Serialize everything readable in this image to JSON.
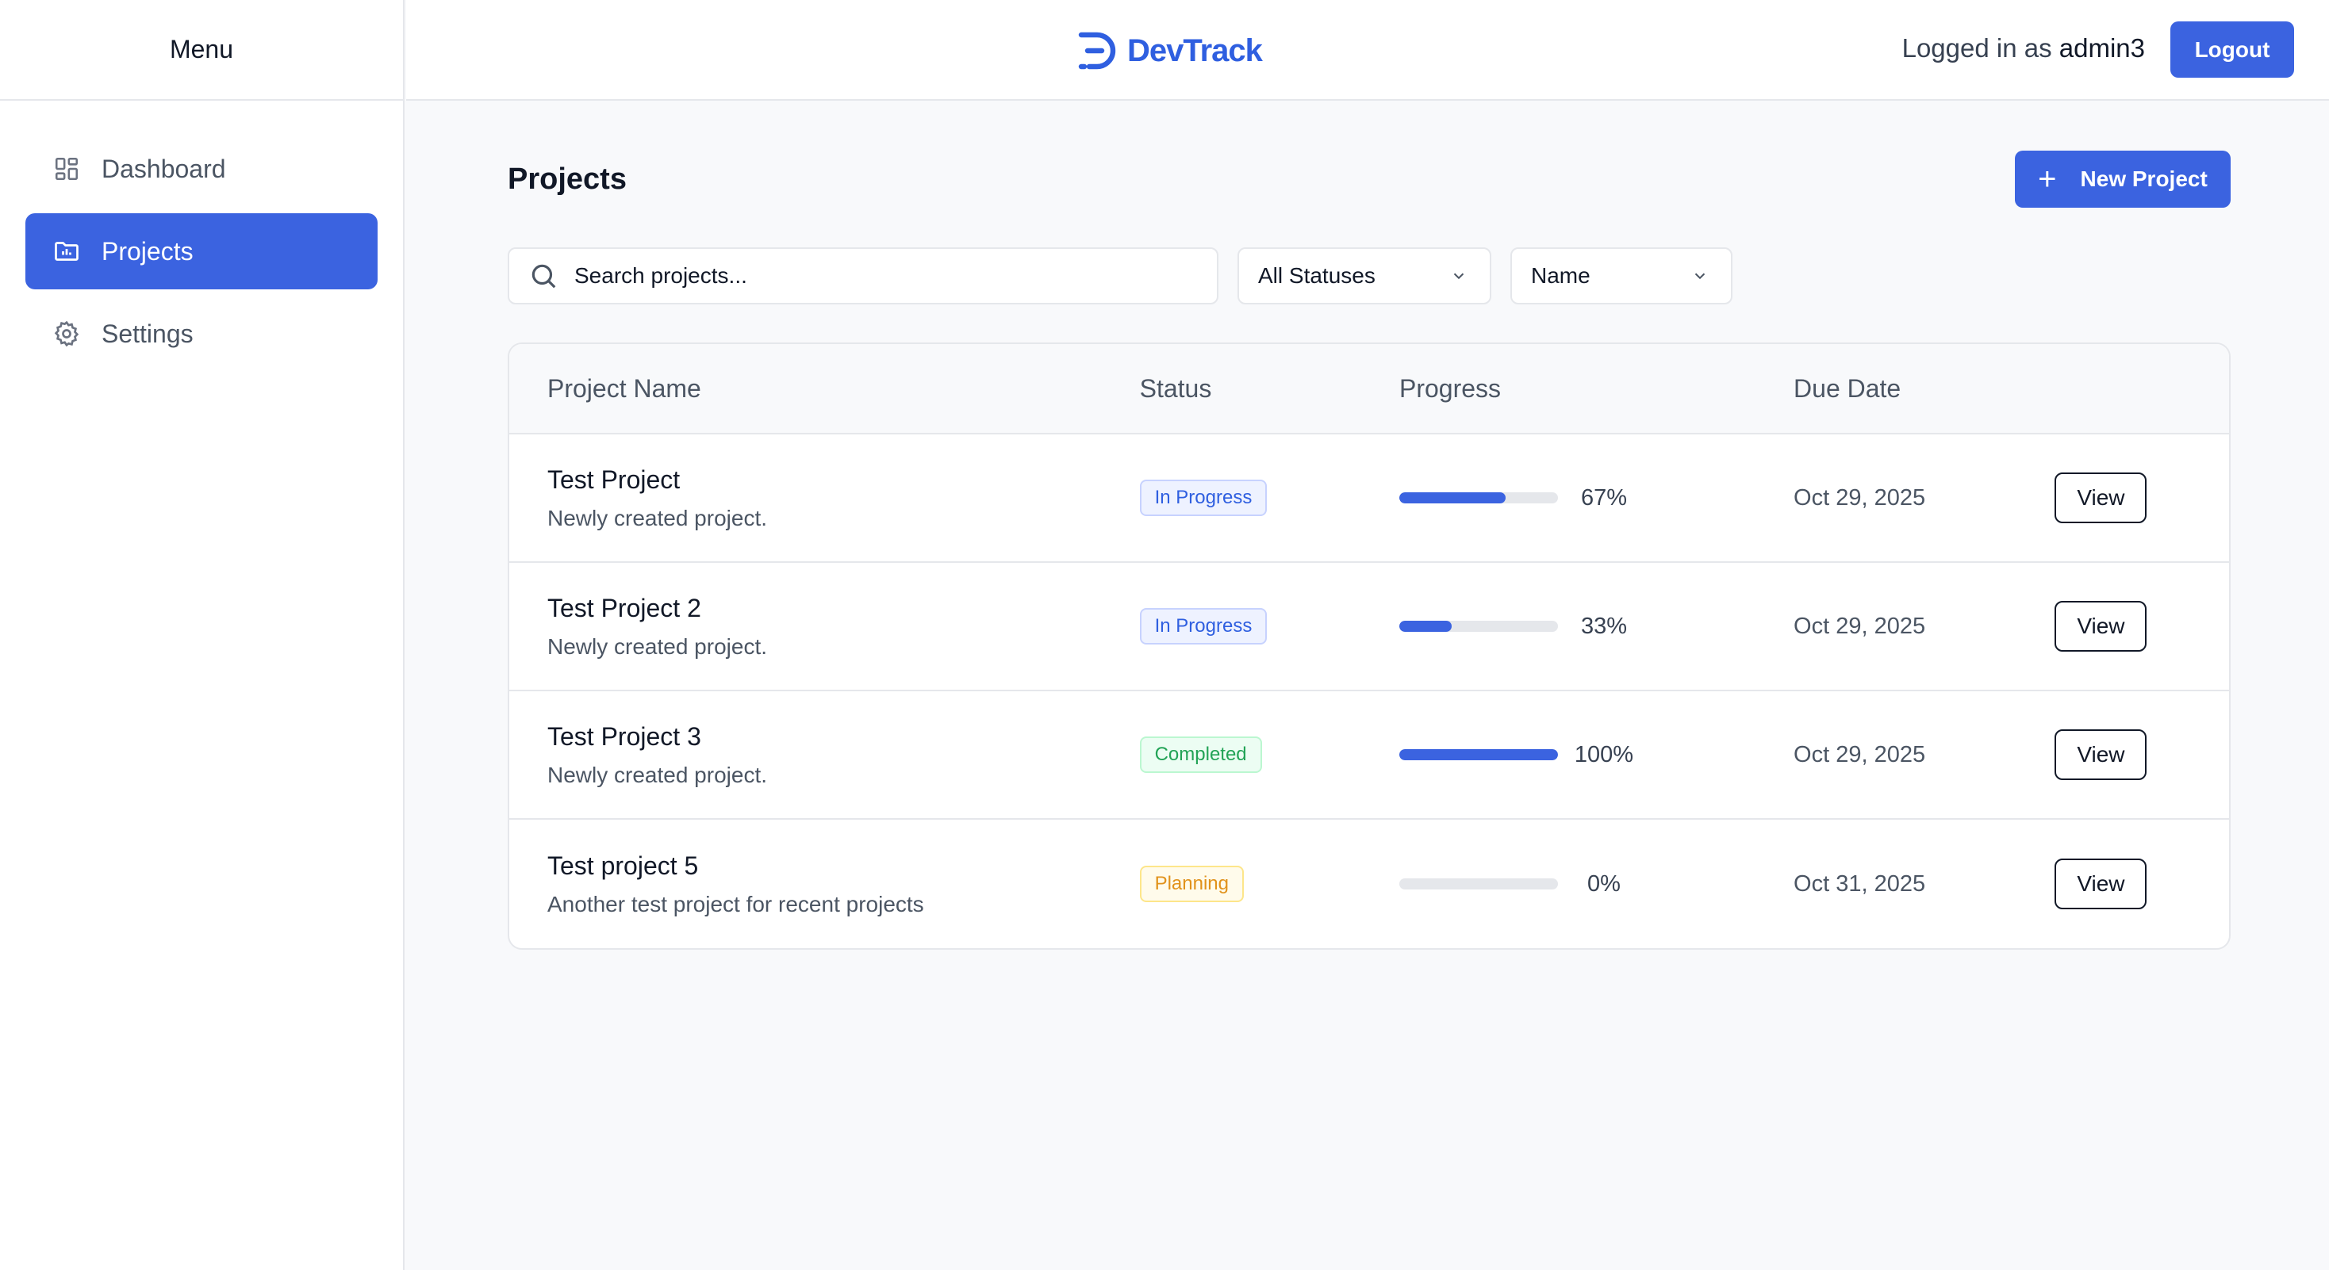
{
  "sidebar": {
    "heading": "Menu",
    "items": [
      {
        "label": "Dashboard",
        "icon": "dashboard-icon"
      },
      {
        "label": "Projects",
        "icon": "folder-chart-icon",
        "active": true
      },
      {
        "label": "Settings",
        "icon": "gear-icon"
      }
    ]
  },
  "header": {
    "brand": "DevTrack",
    "logged_in_prefix": "Logged in as",
    "username": "admin3",
    "logout_label": "Logout"
  },
  "main": {
    "title": "Projects",
    "new_button_label": "New Project",
    "search_placeholder": "Search projects...",
    "status_filter": "All Statuses",
    "sort_by": "Name",
    "columns": [
      "Project Name",
      "Status",
      "Progress",
      "Due Date"
    ],
    "rows": [
      {
        "name": "Test Project",
        "description": "Newly created project.",
        "status": "In Progress",
        "status_kind": "progress",
        "progress": 67,
        "progress_label": "67%",
        "due": "Oct 29, 2025",
        "action": "View"
      },
      {
        "name": "Test Project 2",
        "description": "Newly created project.",
        "status": "In Progress",
        "status_kind": "progress",
        "progress": 33,
        "progress_label": "33%",
        "due": "Oct 29, 2025",
        "action": "View"
      },
      {
        "name": "Test Project 3",
        "description": "Newly created project.",
        "status": "Completed",
        "status_kind": "completed",
        "progress": 100,
        "progress_label": "100%",
        "due": "Oct 29, 2025",
        "action": "View"
      },
      {
        "name": "Test project 5",
        "description": "Another test project for recent projects",
        "status": "Planning",
        "status_kind": "planning",
        "progress": 0,
        "progress_label": "0%",
        "due": "Oct 31, 2025",
        "action": "View"
      }
    ]
  },
  "colors": {
    "accent": "#3b63e0",
    "brand": "#2f5fe0",
    "in_progress": "#2f5fe0",
    "completed": "#22a356",
    "planning": "#e1921b"
  }
}
